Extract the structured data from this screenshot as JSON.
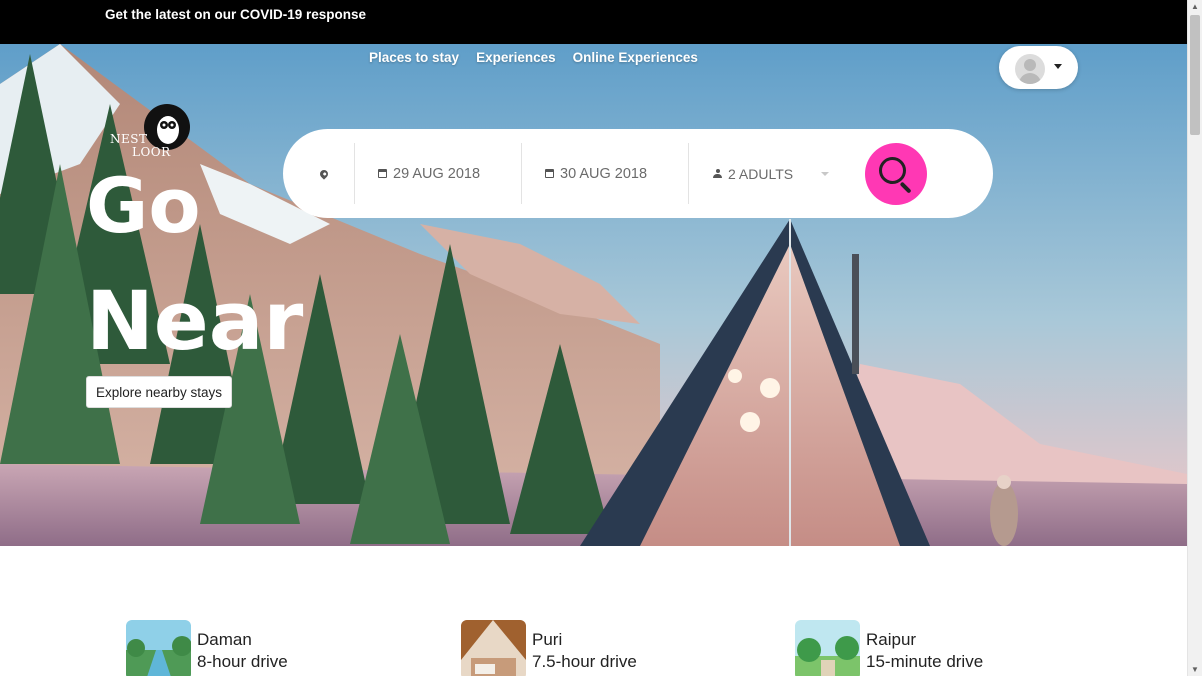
{
  "banner": {
    "text": "Get the latest on our COVID-19 response"
  },
  "nav": {
    "items": [
      "Places to stay",
      "Experiences",
      "Online Experiences"
    ]
  },
  "logo": {
    "line1": "NEST",
    "line2": "LOOR"
  },
  "search": {
    "check_in": "29 AUG 2018",
    "check_out": "30 AUG 2018",
    "guests": "2 ADULTS"
  },
  "hero": {
    "headline_line1": "Go",
    "headline_line2": "Near",
    "cta_label": "Explore nearby stays"
  },
  "destinations": [
    {
      "name": "Daman",
      "time": "8-hour drive"
    },
    {
      "name": "Puri",
      "time": "7.5-hour drive"
    },
    {
      "name": "Raipur",
      "time": "15-minute drive"
    }
  ],
  "colors": {
    "accent": "#ff38b4",
    "banner": "#000000"
  },
  "icons": [
    "location-pin-icon",
    "calendar-icon",
    "person-icon",
    "search-icon",
    "user-avatar-icon",
    "chevron-down-icon"
  ]
}
